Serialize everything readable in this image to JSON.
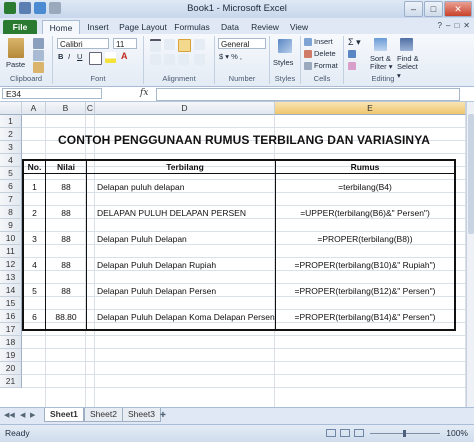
{
  "window": {
    "title": "Book1 - Microsoft Excel",
    "min": "–",
    "max": "□",
    "close": "✕"
  },
  "tabs": [
    "File",
    "Home",
    "Insert",
    "Page Layout",
    "Formulas",
    "Data",
    "Review",
    "View"
  ],
  "ribbon": {
    "paste": "Paste",
    "clipboard": "Clipboard",
    "font_name": "Calibri",
    "font_size": "11",
    "font": "Font",
    "alignment": "Alignment",
    "number_format": "General",
    "currency": "$ ▾ % ,",
    "number": "Number",
    "styles": "Styles",
    "insert": "Insert",
    "delete": "Delete",
    "format": "Format",
    "cells": "Cells",
    "sort_filter_1": "Sort &",
    "sort_filter_2": "Filter ▾",
    "find_select_1": "Find &",
    "find_select_2": "Select ▾",
    "editing": "Editing",
    "sigma": "Σ ▾"
  },
  "formula_bar": {
    "name_box": "E34",
    "fx": "fx"
  },
  "columns": [
    "A",
    "B",
    "C",
    "D",
    "E"
  ],
  "rows": [
    "1",
    "2",
    "3",
    "4",
    "5",
    "6",
    "7",
    "8",
    "9",
    "10",
    "11",
    "12",
    "13",
    "14",
    "15",
    "16",
    "17",
    "18",
    "19",
    "20",
    "21"
  ],
  "sheet": {
    "heading": "CONTOH PENGGUNAAN RUMUS TERBILANG DAN VARIASINYA",
    "headers": {
      "no": "No.",
      "nilai": "Nilai",
      "terbilang": "Terbilang",
      "rumus": "Rumus"
    },
    "records": [
      {
        "no": "1",
        "nilai": "88",
        "terbilang": "Delapan puluh delapan",
        "rumus": "=terbilang(B4)"
      },
      {
        "no": "2",
        "nilai": "88",
        "terbilang": "DELAPAN PULUH DELAPAN PERSEN",
        "rumus": "=UPPER(terbilang(B6)&\" Persen\")"
      },
      {
        "no": "3",
        "nilai": "88",
        "terbilang": "Delapan Puluh Delapan",
        "rumus": "=PROPER(terbilang(B8))"
      },
      {
        "no": "4",
        "nilai": "88",
        "terbilang": "Delapan Puluh Delapan Rupiah",
        "rumus": "=PROPER(terbilang(B10)&\" Rupiah\")"
      },
      {
        "no": "5",
        "nilai": "88",
        "terbilang": "Delapan Puluh Delapan Persen",
        "rumus": "=PROPER(terbilang(B12)&\" Persen\")"
      },
      {
        "no": "6",
        "nilai": "88.80",
        "terbilang": "Delapan Puluh Delapan Koma Delapan Persen",
        "rumus": "=PROPER(terbilang(B14)&\" Persen\")"
      }
    ]
  },
  "sheet_tabs": [
    "Sheet1",
    "Sheet2",
    "Sheet3"
  ],
  "status": {
    "ready": "Ready",
    "zoom": "100%"
  },
  "colors": {
    "file_tab": "#2a7a32",
    "grid_line": "#d9e0e8",
    "selected_col_header": "#f0c66c"
  }
}
